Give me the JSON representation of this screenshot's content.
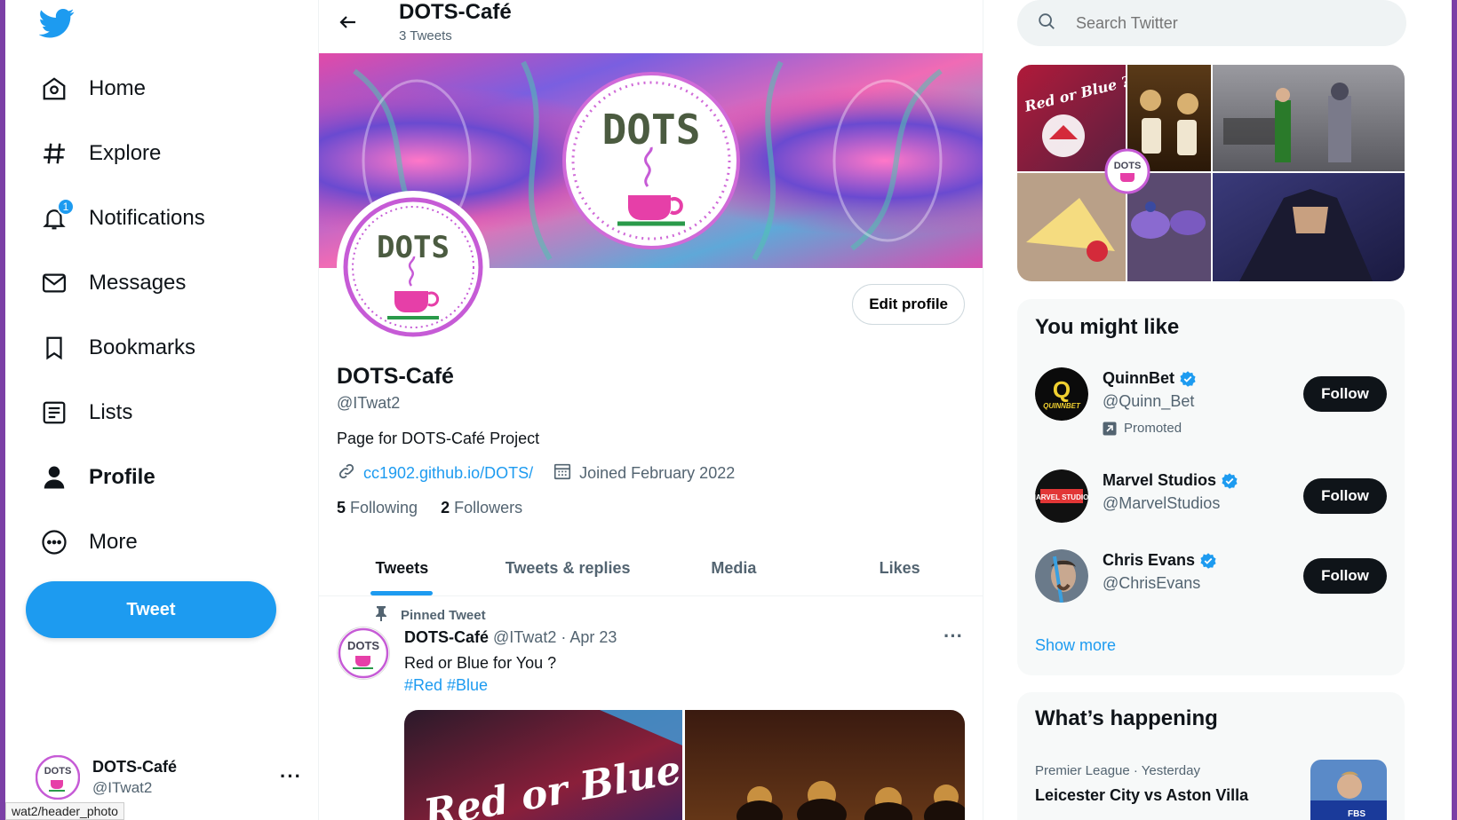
{
  "nav": {
    "items": [
      {
        "label": "Home",
        "icon": "home-icon"
      },
      {
        "label": "Explore",
        "icon": "hashtag-icon"
      },
      {
        "label": "Notifications",
        "icon": "bell-icon",
        "badge": "1"
      },
      {
        "label": "Messages",
        "icon": "envelope-icon"
      },
      {
        "label": "Bookmarks",
        "icon": "bookmark-icon"
      },
      {
        "label": "Lists",
        "icon": "list-icon"
      },
      {
        "label": "Profile",
        "icon": "person-icon",
        "active": true
      },
      {
        "label": "More",
        "icon": "more-circle-icon"
      }
    ],
    "tweet_label": "Tweet",
    "account": {
      "name": "DOTS-Café",
      "handle": "@ITwat2"
    }
  },
  "status_url": "wat2/header_photo",
  "header": {
    "title": "DOTS-Café",
    "subtitle": "3 Tweets"
  },
  "banner": {
    "logo_text": "DOTS"
  },
  "profile": {
    "avatar_text": "DOTS",
    "edit_label": "Edit profile",
    "name": "DOTS-Café",
    "handle": "@ITwat2",
    "bio": "Page for DOTS-Café Project",
    "link": "cc1902.github.io/DOTS/",
    "joined": "Joined February 2022",
    "following_count": "5",
    "following_label": "Following",
    "followers_count": "2",
    "followers_label": "Followers"
  },
  "tabs": [
    "Tweets",
    "Tweets & replies",
    "Media",
    "Likes"
  ],
  "pinned_tweet": {
    "pinned_label": "Pinned Tweet",
    "name": "DOTS-Café",
    "meta": "@ITwat2 · Apr 23",
    "more": "···",
    "text": "Red or Blue for You ?",
    "tags": "#Red #Blue",
    "media_caption": "Red or Blue ?"
  },
  "search": {
    "placeholder": "Search Twitter"
  },
  "media_grid": {
    "caption": "Red or Blue ?",
    "logo": "DOTS"
  },
  "you_might_like": {
    "title": "You might like",
    "users": [
      {
        "name": "QuinnBet",
        "handle": "@Quinn_Bet",
        "promoted": "Promoted",
        "follow": "Follow",
        "avatar_text": "Q",
        "avatar_sub": "QUINNBET"
      },
      {
        "name": "Marvel Studios",
        "handle": "@MarvelStudios",
        "follow": "Follow",
        "avatar_text": "MARVEL STUDIOS"
      },
      {
        "name": "Chris Evans",
        "handle": "@ChrisEvans",
        "follow": "Follow"
      }
    ],
    "show_more": "Show more"
  },
  "whats_happening": {
    "title": "What’s happening",
    "trend": {
      "meta": "Premier League · Yesterday",
      "title": "Leicester City vs Aston Villa",
      "img_text": "FBS"
    }
  },
  "colors": {
    "accent": "#1d9bf0",
    "text": "#0f1419",
    "muted": "#536471",
    "frame": "#7b3fa6"
  }
}
